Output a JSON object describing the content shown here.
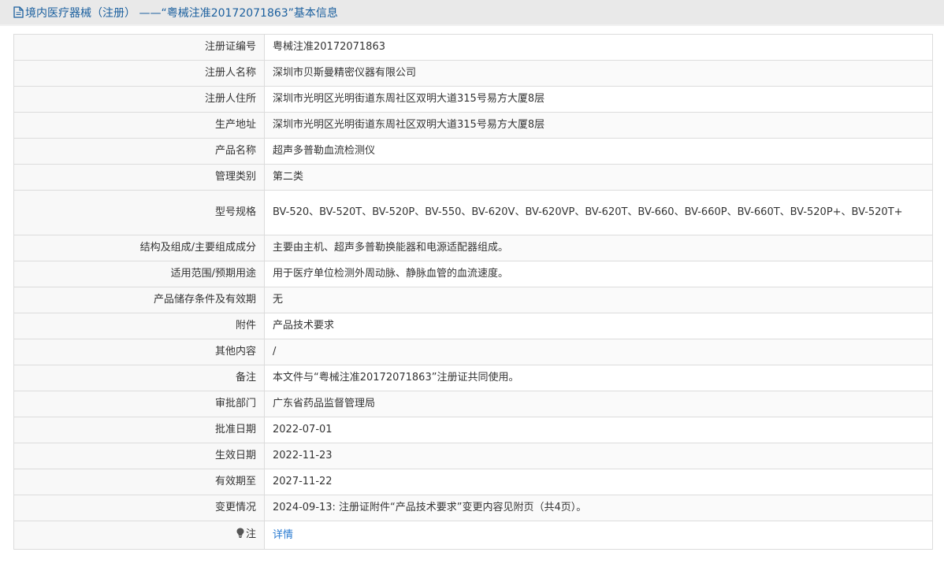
{
  "header": {
    "title": "境内医疗器械（注册） ——“粤械注准20172071863”基本信息"
  },
  "rows": [
    {
      "label": "注册证编号",
      "value": "粤械注准20172071863"
    },
    {
      "label": "注册人名称",
      "value": "深圳市贝斯曼精密仪器有限公司"
    },
    {
      "label": "注册人住所",
      "value": "深圳市光明区光明街道东周社区双明大道315号易方大厦8层"
    },
    {
      "label": "生产地址",
      "value": "深圳市光明区光明街道东周社区双明大道315号易方大厦8层"
    },
    {
      "label": "产品名称",
      "value": "超声多普勒血流检测仪"
    },
    {
      "label": "管理类别",
      "value": "第二类"
    },
    {
      "label": "型号规格",
      "value": "BV-520、BV-520T、BV-520P、BV-550、BV-620V、BV-620VP、BV-620T、BV-660、BV-660P、BV-660T、BV-520P+、BV-520T+"
    },
    {
      "label": "结构及组成/主要组成成分",
      "value": "主要由主机、超声多普勒换能器和电源适配器组成。"
    },
    {
      "label": "适用范围/预期用途",
      "value": "用于医疗单位检测外周动脉、静脉血管的血流速度。"
    },
    {
      "label": "产品储存条件及有效期",
      "value": "无"
    },
    {
      "label": "附件",
      "value": "产品技术要求"
    },
    {
      "label": "其他内容",
      "value": "/"
    },
    {
      "label": "备注",
      "value": "本文件与“粤械注准20172071863”注册证共同使用。"
    },
    {
      "label": "审批部门",
      "value": "广东省药品监督管理局"
    },
    {
      "label": "批准日期",
      "value": "2022-07-01"
    },
    {
      "label": "生效日期",
      "value": "2022-11-23"
    },
    {
      "label": "有效期至",
      "value": "2027-11-22"
    },
    {
      "label": "变更情况",
      "value": "2024-09-13: 注册证附件“产品技术要求”变更内容见附页（共4页）。"
    }
  ],
  "note": {
    "label": "注",
    "link_text": "详情"
  },
  "icons": {
    "header_icon": "document-icon",
    "note_icon": "lightbulb-icon"
  },
  "colors": {
    "header_text": "#1a5f9e",
    "link": "#2a7bd1"
  }
}
